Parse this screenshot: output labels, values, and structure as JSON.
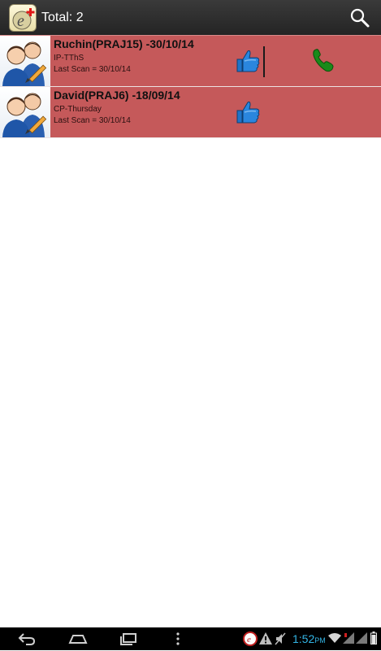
{
  "action_bar": {
    "title": "Total: 2",
    "app_icon": "app-logo-e-plus",
    "search_icon": "search-icon"
  },
  "contacts": [
    {
      "name": "Ruchin(PRAJ15) -30/10/14",
      "batch": "IP-TThS",
      "last_scan": "Last Scan = 30/10/14",
      "has_call": true
    },
    {
      "name": "David(PRAJ6) -18/09/14",
      "batch": "CP-Thursday",
      "last_scan": "Last Scan = 30/10/14",
      "has_call": false
    }
  ],
  "status_bar": {
    "time": "1:52",
    "ampm": "PM"
  },
  "colors": {
    "row_background": "#c5595a",
    "action_bar": "#2b2b2b",
    "clock": "#33b5e5",
    "thumb_blue": "#1f74c8",
    "call_green": "#1a8a1a"
  }
}
